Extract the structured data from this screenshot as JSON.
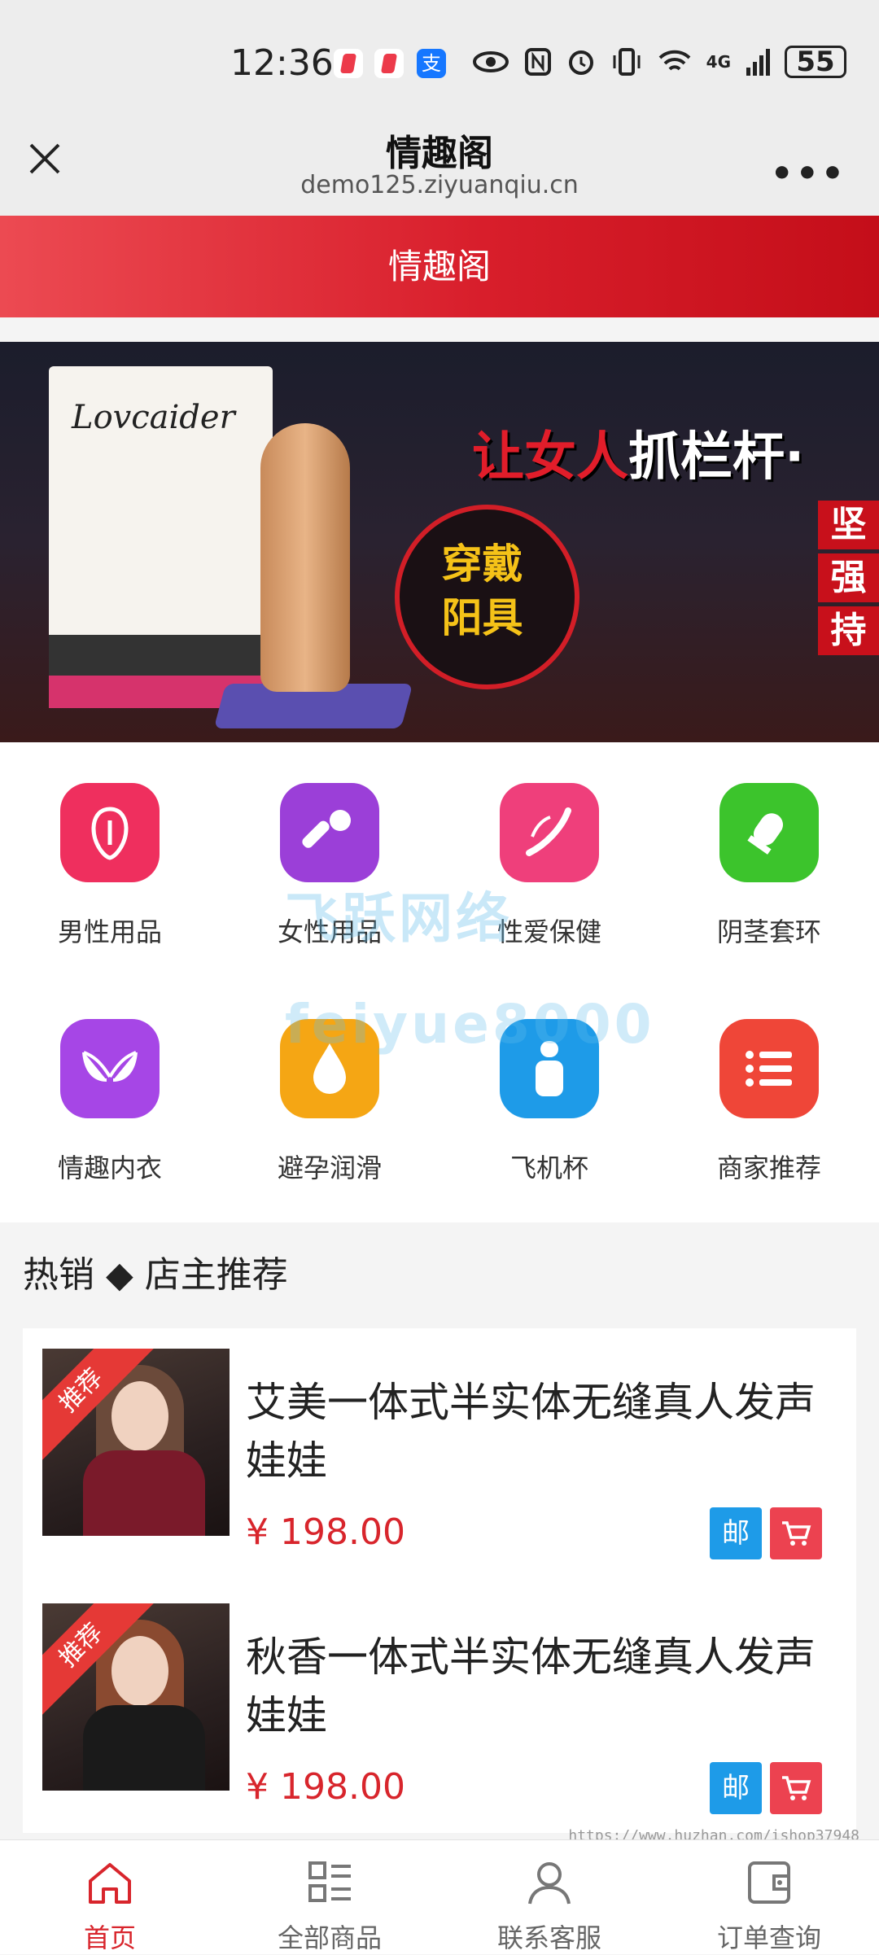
{
  "status_bar": {
    "time": "12:36",
    "network": "4G",
    "battery": "55",
    "app_icons": [
      "red-app-icon",
      "red-app-icon",
      "alipay-icon"
    ]
  },
  "browser": {
    "title": "情趣阁",
    "url": "demo125.ziyuanqiu.cn",
    "more_label": "•••"
  },
  "header": {
    "title": "情趣阁"
  },
  "banner": {
    "brand": "Lovcaider",
    "bubble_text_1": "穿戴",
    "bubble_text_2": "阳具",
    "headline_red": "让女人",
    "headline_white": "抓栏杆·",
    "side_tags": [
      "坚",
      "强",
      "持"
    ]
  },
  "categories": [
    {
      "label": "男性用品",
      "icon": "male-icon",
      "color": "#ef2f5e"
    },
    {
      "label": "女性用品",
      "icon": "massager-icon",
      "color": "#9b3fd8"
    },
    {
      "label": "性爱保健",
      "icon": "health-icon",
      "color": "#ef3f7b"
    },
    {
      "label": "阴茎套环",
      "icon": "condom-icon",
      "color": "#3cc42c"
    },
    {
      "label": "情趣内衣",
      "icon": "lingerie-icon",
      "color": "#a646e6"
    },
    {
      "label": "避孕润滑",
      "icon": "drop-icon",
      "color": "#f5a614"
    },
    {
      "label": "飞机杯",
      "icon": "cup-icon",
      "color": "#1e9be8"
    },
    {
      "label": "商家推荐",
      "icon": "list-icon",
      "color": "#ef4638"
    }
  ],
  "watermark": {
    "line1": "飞跃网络",
    "line2": "feiyue8000"
  },
  "section": {
    "title": "热销 ◆ 店主推荐"
  },
  "products": [
    {
      "badge": "推荐",
      "title": "艾美一体式半实体无缝真人发声娃娃",
      "price": "¥ 198.00",
      "mail_label": "邮"
    },
    {
      "badge": "推荐",
      "title": "秋香一体式半实体无缝真人发声娃娃",
      "price": "¥ 198.00",
      "mail_label": "邮"
    }
  ],
  "url_watermark": "https://www.huzhan.com/ishop37948",
  "tabbar": [
    {
      "label": "首页",
      "icon": "home-icon",
      "active": true
    },
    {
      "label": "全部商品",
      "icon": "grid-icon",
      "active": false
    },
    {
      "label": "联系客服",
      "icon": "user-icon",
      "active": false
    },
    {
      "label": "订单查询",
      "icon": "wallet-icon",
      "active": false
    }
  ],
  "colors": {
    "accent": "#d8252c",
    "mail_button": "#1e9be8",
    "cart_button": "#ec4250"
  }
}
